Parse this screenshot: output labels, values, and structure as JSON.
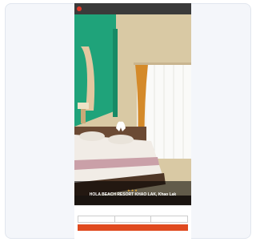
{
  "topbar": {
    "nav_links": [
      "",
      "",
      ""
    ],
    "right_links": [
      "",
      ""
    ]
  },
  "hero": {
    "stars": "★★★",
    "hotel_name": "HOLA BEACH RESORT KHAO LAK, Khao Lak",
    "accent_color": "#1fa37a"
  },
  "booking": {
    "subtitle": "",
    "title": "",
    "fields": [
      "",
      "",
      ""
    ],
    "search_label": "",
    "button_color": "#e04a1f"
  }
}
